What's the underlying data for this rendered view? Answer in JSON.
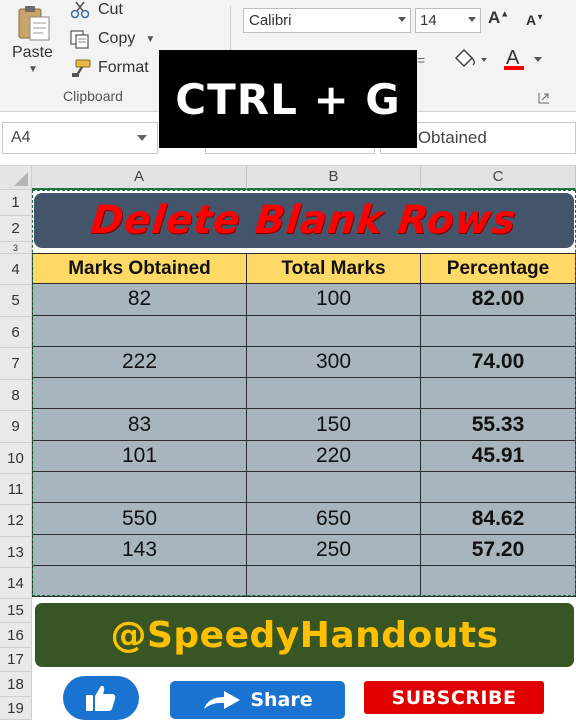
{
  "ribbon": {
    "clipboard": {
      "paste_label": "Paste",
      "cut_label": "Cut",
      "copy_label": "Copy",
      "format_label": "Format",
      "group_label": "Clipboard"
    },
    "font": {
      "font_name": "Calibri",
      "font_size": "14",
      "grow_icon": "A",
      "shrink_icon": "A",
      "font_color_icon": "A",
      "font_color": "#ff0000"
    },
    "mid_fragment": "=",
    "launcher_icon": "dialog-launcher-icon"
  },
  "formula_bar": {
    "name_box": "A4",
    "value": "arks Obtained"
  },
  "overlay": {
    "text": "CTRL + G"
  },
  "grid": {
    "columns": [
      "A",
      "B",
      "C"
    ],
    "rows": [
      "1",
      "2",
      "3",
      "4",
      "5",
      "6",
      "7",
      "8",
      "9",
      "10",
      "11",
      "12",
      "13",
      "14",
      "15",
      "16",
      "17",
      "18",
      "19"
    ]
  },
  "sheet": {
    "title": "Delete Blank Rows",
    "headers": [
      "Marks Obtained",
      "Total Marks",
      "Percentage"
    ],
    "rows": [
      [
        "82",
        "100",
        "82.00"
      ],
      [
        "",
        "",
        ""
      ],
      [
        "222",
        "300",
        "74.00"
      ],
      [
        "",
        "",
        ""
      ],
      [
        "83",
        "150",
        "55.33"
      ],
      [
        "101",
        "220",
        "45.91"
      ],
      [
        "",
        "",
        ""
      ],
      [
        "550",
        "650",
        "84.62"
      ],
      [
        "143",
        "250",
        "57.20"
      ],
      [
        "",
        "",
        ""
      ]
    ]
  },
  "brand": {
    "handle": "@SpeedyHandouts"
  },
  "social": {
    "like_icon": "thumbs-up-icon",
    "share_label": "Share",
    "subscribe_label": "SUBSCRIBE"
  },
  "colors": {
    "header_fill": "#ffd966",
    "data_fill": "#a9b5bd",
    "title_fill": "#44546a",
    "title_text": "#ff0000",
    "brand_fill": "#375623",
    "brand_text": "#ffc000",
    "share_blue": "#1a73d1",
    "subscribe_red": "#e00000"
  }
}
